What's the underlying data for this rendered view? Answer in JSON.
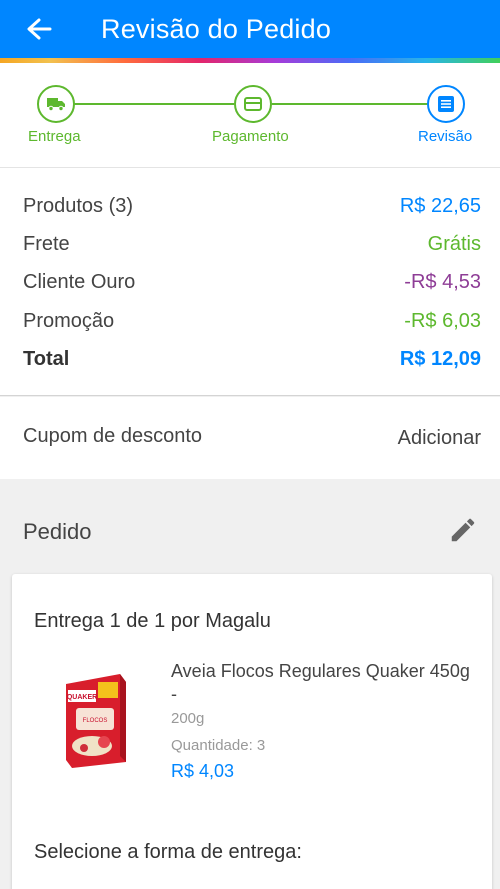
{
  "header": {
    "title": "Revisão do Pedido",
    "back_icon": "arrow-left-icon",
    "background": "#0086ff"
  },
  "steps": [
    {
      "label": "Entrega",
      "icon": "truck-icon",
      "state": "done"
    },
    {
      "label": "Pagamento",
      "icon": "card-icon",
      "state": "done"
    },
    {
      "label": "Revisão",
      "icon": "list-icon",
      "state": "active"
    }
  ],
  "summary": {
    "products": {
      "label": "Produtos (3)",
      "value": "R$ 22,65",
      "color": "#0086ff"
    },
    "shipping": {
      "label": "Frete",
      "value": "Grátis",
      "color": "#5db82e"
    },
    "gold_client": {
      "label": "Cliente Ouro",
      "value": "-R$ 4,53",
      "color": "#8e3d96"
    },
    "promotion": {
      "label": "Promoção",
      "value": "-R$ 6,03",
      "color": "#5db82e"
    },
    "total": {
      "label": "Total",
      "value": "R$ 12,09",
      "color": "#0086ff"
    }
  },
  "coupon": {
    "label": "Cupom de desconto",
    "action": "Adicionar"
  },
  "order": {
    "title": "Pedido",
    "edit_icon": "pencil-icon",
    "delivery_title": "Entrega 1 de 1 por Magalu",
    "product": {
      "name": "Aveia Flocos Regulares Quaker 450g -",
      "weight": "200g",
      "quantity": "Quantidade:  3",
      "price": "R$ 4,03",
      "image_brand": "QUAKER",
      "image_text": "FLOCOS"
    },
    "select_delivery": "Selecione a forma de entrega:"
  }
}
